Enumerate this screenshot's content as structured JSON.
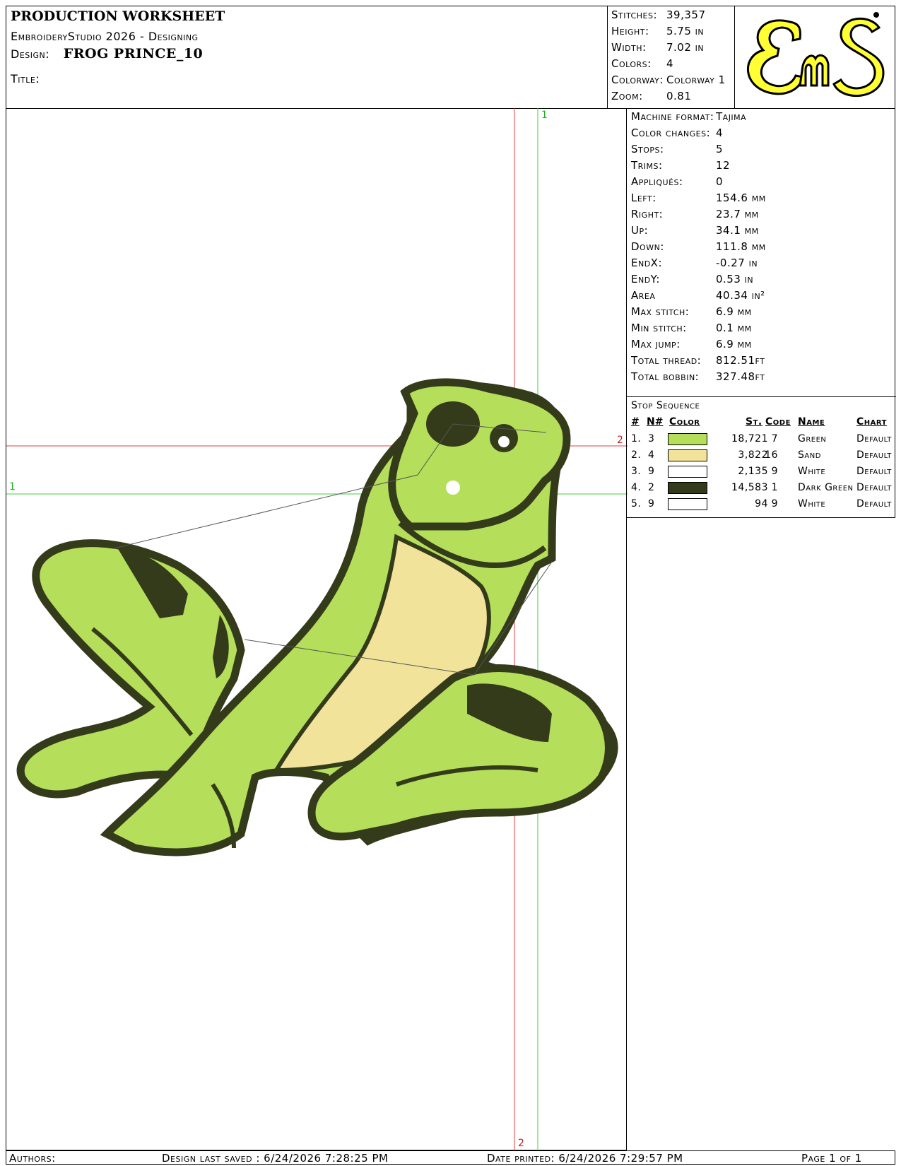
{
  "header": {
    "title": "PRODUCTION WORKSHEET",
    "app": "EmbroideryStudio 2026 - Designing",
    "design_label": "Design:",
    "design_value": "FROG PRINCE_10",
    "title_label": "Title:"
  },
  "stats": [
    {
      "label": "Stitches:",
      "value": "39,357"
    },
    {
      "label": "Height:",
      "value": "5.75 in"
    },
    {
      "label": "Width:",
      "value": "7.02 in"
    },
    {
      "label": "Colors:",
      "value": "4"
    },
    {
      "label": "Colorway:",
      "value": "Colorway 1"
    },
    {
      "label": "Zoom:",
      "value": "0.81"
    }
  ],
  "logo": {
    "text": "EnS",
    "bg_color": "#ffff33",
    "fg_color": "#000000"
  },
  "params": [
    {
      "label": "Machine format:",
      "value": "Tajima"
    },
    {
      "label": "Color changes:",
      "value": "4"
    },
    {
      "label": "Stops:",
      "value": "5"
    },
    {
      "label": "Trims:",
      "value": "12"
    },
    {
      "label": "Appliqués:",
      "value": "0"
    },
    {
      "label": "Left:",
      "value": "154.6 mm"
    },
    {
      "label": "Right:",
      "value": "23.7 mm"
    },
    {
      "label": "Up:",
      "value": "34.1 mm"
    },
    {
      "label": "Down:",
      "value": "111.8 mm"
    },
    {
      "label": "EndX:",
      "value": "-0.27 in"
    },
    {
      "label": "EndY:",
      "value": "0.53 in"
    },
    {
      "label": "Area",
      "value": "40.34 in²"
    },
    {
      "label": "Max stitch:",
      "value": "6.9 mm"
    },
    {
      "label": "Min stitch:",
      "value": "0.1 mm"
    },
    {
      "label": "Max jump:",
      "value": "6.9 mm"
    },
    {
      "label": "Total thread:",
      "value": "812.51ft"
    },
    {
      "label": "Total bobbin:",
      "value": "327.48ft"
    }
  ],
  "stop_sequence": {
    "title": "Stop Sequence",
    "headers": {
      "num": "#",
      "n": "N#",
      "color": "Color",
      "st": "St.",
      "code": "Code",
      "name": "Name",
      "chart": "Chart"
    },
    "rows": [
      {
        "num": "1.",
        "n": "3",
        "color": "#b5df5a",
        "st": "18,721",
        "code": "7",
        "name": "Green",
        "chart": "Default"
      },
      {
        "num": "2.",
        "n": "4",
        "color": "#f2e39a",
        "st": "3,822",
        "code": "16",
        "name": "Sand",
        "chart": "Default"
      },
      {
        "num": "3.",
        "n": "9",
        "color": "#ffffff",
        "st": "2,135",
        "code": "9",
        "name": "White",
        "chart": "Default"
      },
      {
        "num": "4.",
        "n": "2",
        "color": "#343b1b",
        "st": "14,583",
        "code": "1",
        "name": "Dark Green",
        "chart": "Default"
      },
      {
        "num": "5.",
        "n": "9",
        "color": "#ffffff",
        "st": "94",
        "code": "9",
        "name": "White",
        "chart": "Default"
      }
    ]
  },
  "guides": {
    "label_1": "1",
    "label_2": "2"
  },
  "footer": {
    "authors": "Authors:",
    "saved": "Design last saved : 6/24/2026 7:28:25 PM",
    "printed": "Date printed: 6/24/2026 7:29:57 PM",
    "page": "Page 1 of 1"
  }
}
